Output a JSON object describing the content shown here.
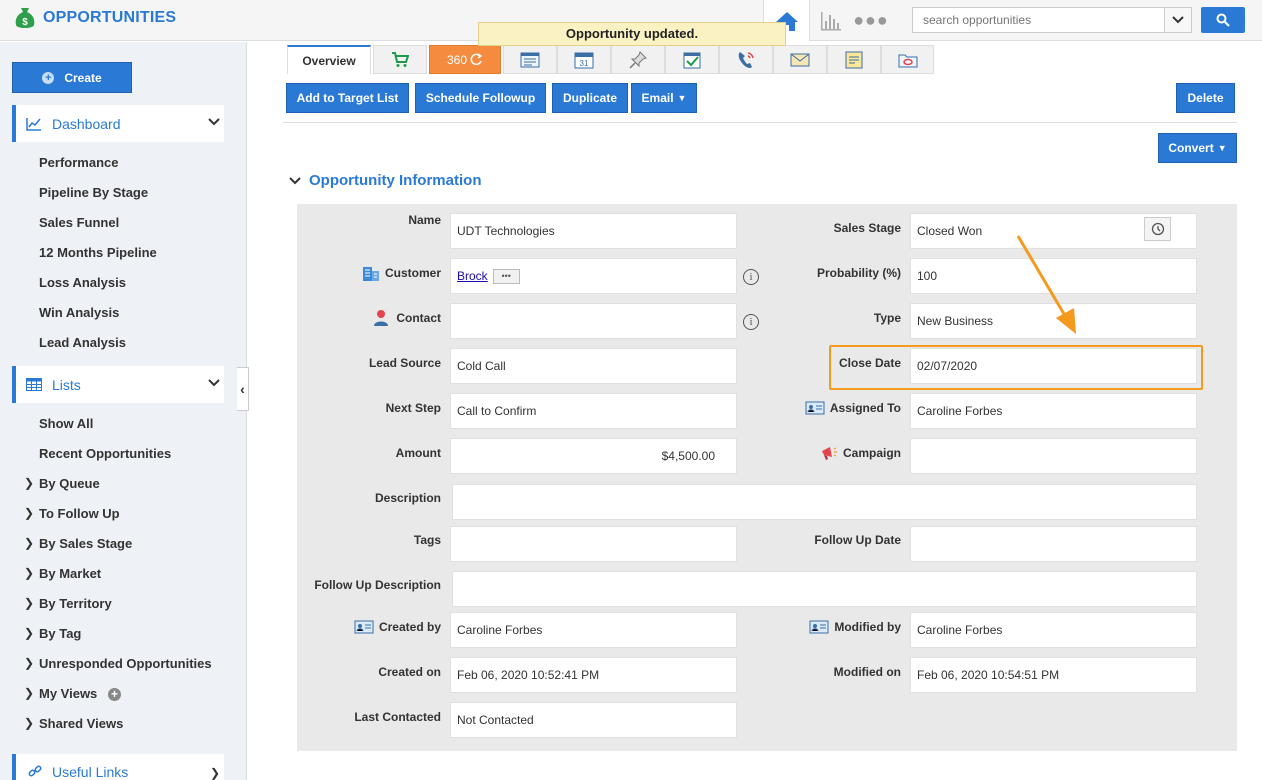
{
  "app": {
    "title": "OPPORTUNITIES",
    "toast": "Opportunity updated.",
    "search_placeholder": "search opportunities"
  },
  "sidebar": {
    "create_label": "Create",
    "dashboard_label": "Dashboard",
    "dashboard_items": [
      "Performance",
      "Pipeline By Stage",
      "Sales Funnel",
      "12 Months Pipeline",
      "Loss Analysis",
      "Win Analysis",
      "Lead Analysis"
    ],
    "lists_label": "Lists",
    "list_items": [
      "Show All",
      "Recent Opportunities"
    ],
    "expandable_items": [
      "By Queue",
      "To Follow Up",
      "By Sales Stage",
      "By Market",
      "By Territory",
      "By Tag",
      "Unresponded Opportunities",
      "My Views",
      "Shared Views"
    ],
    "useful_links_label": "Useful Links"
  },
  "tabs": {
    "overview_label": "Overview",
    "label_360": "360"
  },
  "actions": {
    "add_to_target_list": "Add to Target List",
    "schedule_followup": "Schedule Followup",
    "duplicate": "Duplicate",
    "email": "Email",
    "delete": "Delete",
    "convert": "Convert"
  },
  "section": {
    "title": "Opportunity Information"
  },
  "fields": {
    "name_label": "Name",
    "name_value": "UDT Technologies",
    "customer_label": "Customer",
    "customer_value": "Brock",
    "contact_label": "Contact",
    "contact_value": "",
    "lead_source_label": "Lead Source",
    "lead_source_value": "Cold Call",
    "next_step_label": "Next Step",
    "next_step_value": "Call to Confirm",
    "amount_label": "Amount",
    "amount_value": "$4,500.00",
    "description_label": "Description",
    "description_value": "",
    "tags_label": "Tags",
    "tags_value": "",
    "follow_up_description_label": "Follow Up Description",
    "follow_up_description_value": "",
    "created_by_label": "Created by",
    "created_by_value": "Caroline Forbes",
    "created_on_label": "Created on",
    "created_on_value": "Feb 06, 2020 10:52:41 PM",
    "last_contacted_label": "Last Contacted",
    "last_contacted_value": "Not Contacted",
    "sales_stage_label": "Sales Stage",
    "sales_stage_value": "Closed Won",
    "probability_label": "Probability (%)",
    "probability_value": "100",
    "type_label": "Type",
    "type_value": "New Business",
    "close_date_label": "Close Date",
    "close_date_value": "02/07/2020",
    "assigned_to_label": "Assigned To",
    "assigned_to_value": "Caroline Forbes",
    "campaign_label": "Campaign",
    "campaign_value": "",
    "follow_up_date_label": "Follow Up Date",
    "follow_up_date_value": "",
    "modified_by_label": "Modified by",
    "modified_by_value": "Caroline Forbes",
    "modified_on_label": "Modified on",
    "modified_on_value": "Feb 06, 2020 10:54:51 PM"
  },
  "colors": {
    "accent": "#2a7ad5",
    "highlight": "#f39a1f",
    "toast_bg": "#fbf2c4"
  }
}
